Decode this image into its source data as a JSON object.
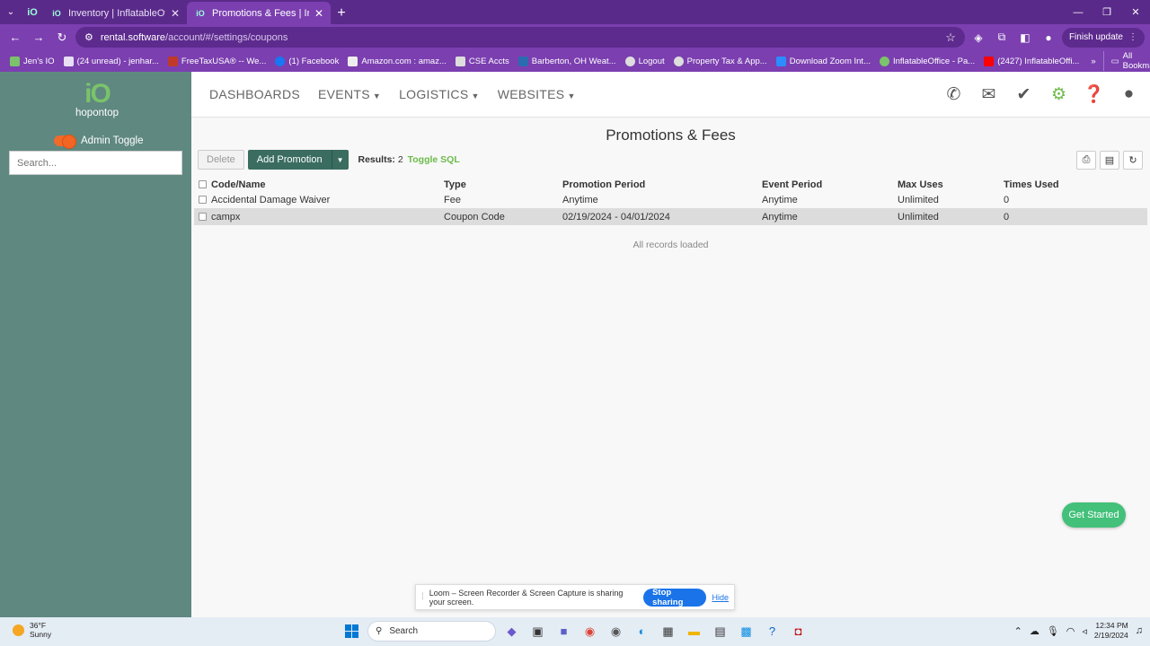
{
  "browser": {
    "tabs": [
      {
        "title": "Inventory | InflatableOffice",
        "active": false
      },
      {
        "title": "Promotions & Fees | InflatableO",
        "active": true
      }
    ],
    "url_host": "rental.software",
    "url_path": "/account/#/settings/coupons",
    "finish_update": "Finish update",
    "bookmarks": [
      {
        "label": "Jen's IO",
        "color": "#7ac36a"
      },
      {
        "label": "(24 unread) - jenhar...",
        "color": "#7b3fb0"
      },
      {
        "label": "FreeTaxUSA® -- We...",
        "color": "#c0392b"
      },
      {
        "label": "(1) Facebook",
        "color": "#1877f2"
      },
      {
        "label": "Amazon.com : amaz...",
        "color": "#222222"
      },
      {
        "label": "CSE Accts",
        "color": "#2c3e50"
      },
      {
        "label": "Barberton, OH Weat...",
        "color": "#2b6cb0"
      },
      {
        "label": "Logout",
        "color": "#444444"
      },
      {
        "label": "Property Tax & App...",
        "color": "#555555"
      },
      {
        "label": "Download Zoom Int...",
        "color": "#2d8cff"
      },
      {
        "label": "InflatableOffice - Pa...",
        "color": "#7ac36a"
      },
      {
        "label": "(2427) InflatableOffi...",
        "color": "#ff0000"
      }
    ],
    "all_bookmarks": "All Bookmarks"
  },
  "sidebar": {
    "logo_mark": "iO",
    "logo_text": "hopontop",
    "admin_toggle": "Admin Toggle",
    "search_placeholder": "Search..."
  },
  "topnav": {
    "items": [
      "DASHBOARDS",
      "EVENTS",
      "LOGISTICS",
      "WEBSITES"
    ],
    "icons": [
      "phone-icon",
      "envelope-icon",
      "check-icon",
      "gear-icon",
      "help-icon",
      "user-icon"
    ]
  },
  "page": {
    "title": "Promotions & Fees",
    "delete_label": "Delete",
    "add_label": "Add Promotion",
    "results_label": "Results:",
    "results_count": "2",
    "toggle_sql": "Toggle SQL",
    "all_loaded": "All records loaded",
    "get_started": "Get Started"
  },
  "table": {
    "headers": {
      "name": "Code/Name",
      "type": "Type",
      "period": "Promotion Period",
      "event": "Event Period",
      "max": "Max Uses",
      "used": "Times Used"
    },
    "rows": [
      {
        "name": "Accidental Damage Waiver",
        "type": "Fee",
        "period": "Anytime",
        "event": "Anytime",
        "max": "Unlimited",
        "used": "0"
      },
      {
        "name": "campx",
        "type": "Coupon Code",
        "period": "02/19/2024 - 04/01/2024",
        "event": "Anytime",
        "max": "Unlimited",
        "used": "0"
      }
    ]
  },
  "loom": {
    "message": "Loom – Screen Recorder & Screen Capture is sharing your screen.",
    "stop": "Stop sharing",
    "hide": "Hide"
  },
  "taskbar": {
    "temp": "36°F",
    "condition": "Sunny",
    "search": "Search",
    "time": "12:34 PM",
    "date": "2/19/2024"
  }
}
